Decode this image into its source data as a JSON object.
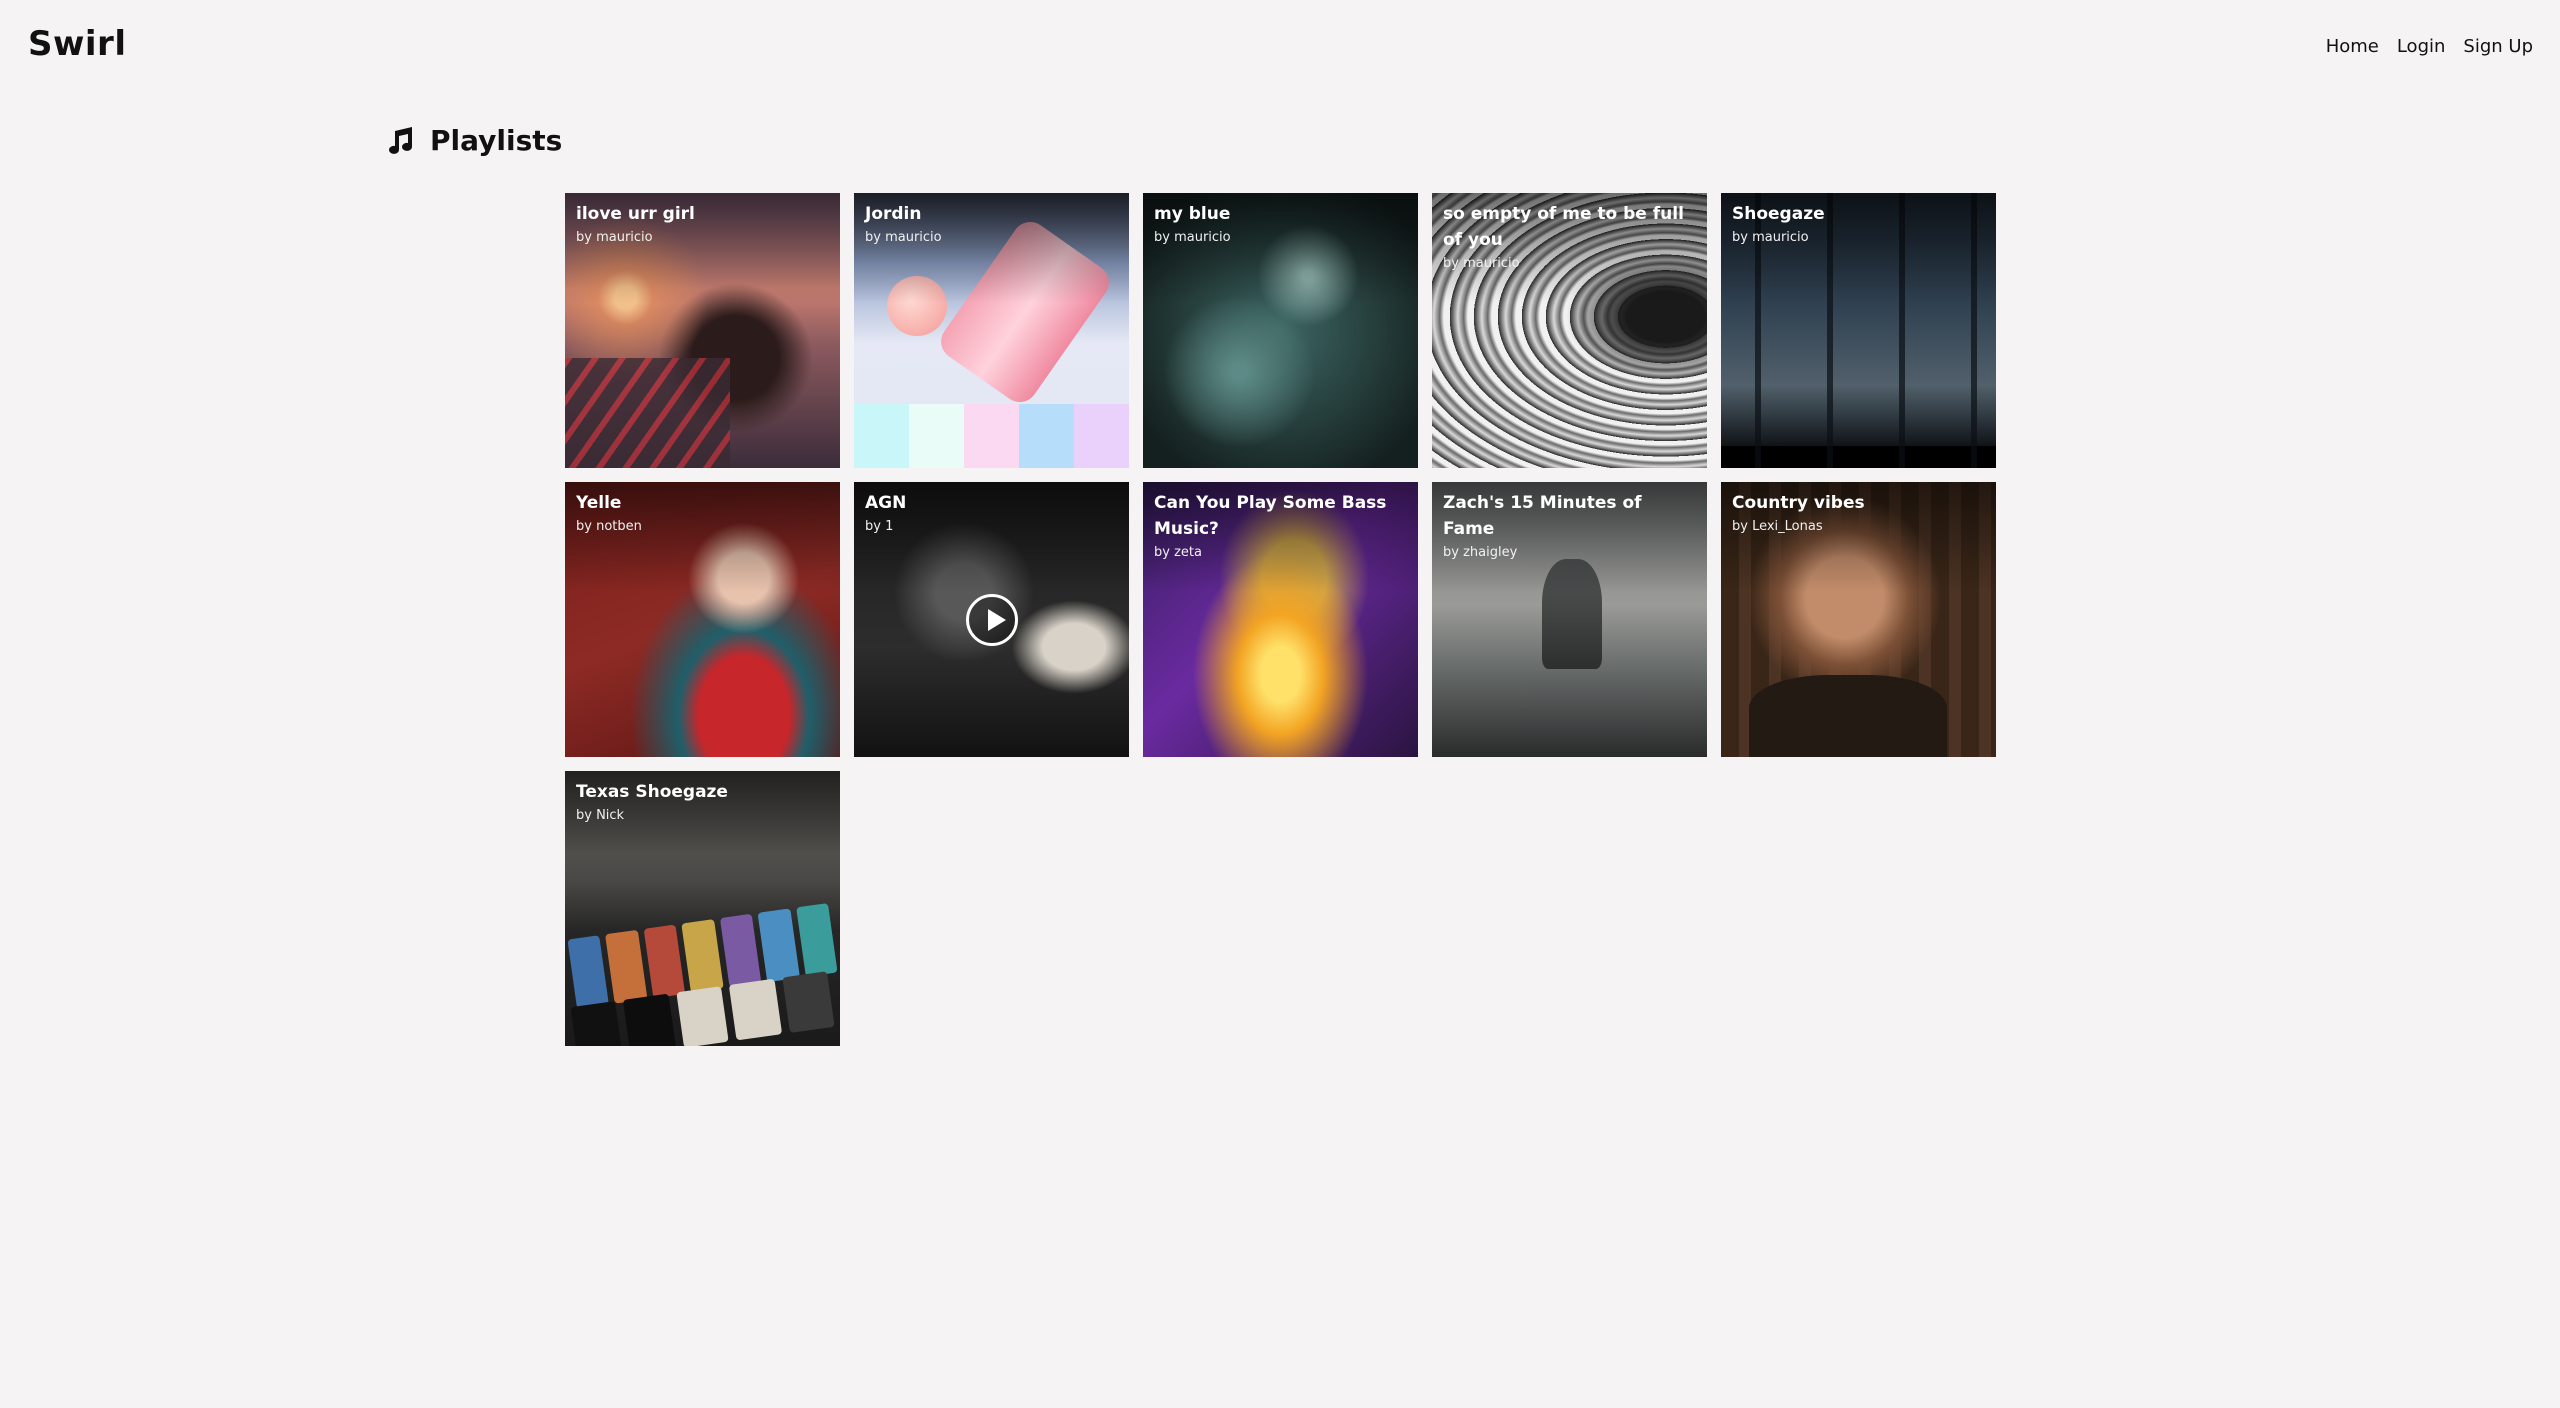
{
  "header": {
    "brand": "Swirl",
    "nav": [
      "Home",
      "Login",
      "Sign Up"
    ]
  },
  "page": {
    "section_title": "Playlists",
    "section_icon": "music-note-icon"
  },
  "playlists": [
    {
      "title": "ilove urr girl",
      "byline": "by mauricio"
    },
    {
      "title": "Jordin",
      "byline": "by mauricio"
    },
    {
      "title": "my blue",
      "byline": "by mauricio"
    },
    {
      "title": "so empty of me to be full of you",
      "byline": "by mauricio"
    },
    {
      "title": "Shoegaze",
      "byline": "by mauricio"
    },
    {
      "title": "Yelle",
      "byline": "by notben"
    },
    {
      "title": "AGN",
      "byline": "by 1"
    },
    {
      "title": "Can You Play Some Bass Music?",
      "byline": "by zeta"
    },
    {
      "title": "Zach's 15 Minutes of Fame",
      "byline": "by zhaigley"
    },
    {
      "title": "Country vibes",
      "byline": "by Lexi_Lonas"
    },
    {
      "title": "Texas Shoegaze",
      "byline": "by Nick"
    }
  ],
  "colors": {
    "background": "#f5f3f3",
    "text": "#111111",
    "overlay_text": "#ffffff"
  }
}
